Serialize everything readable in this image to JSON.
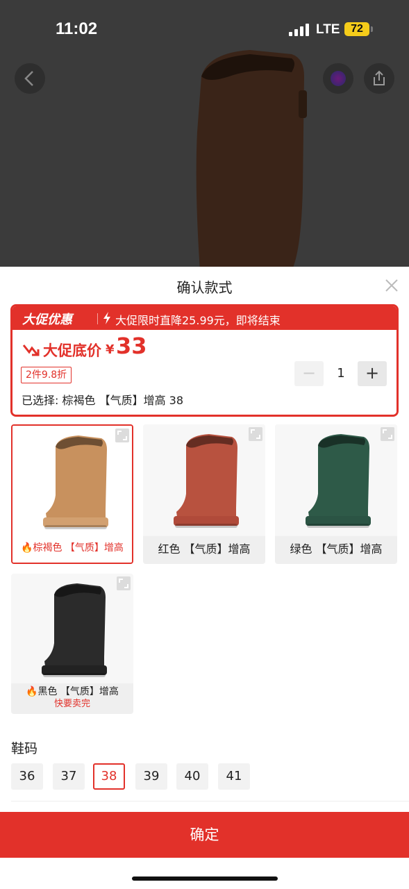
{
  "status": {
    "time": "11:02",
    "network": "LTE",
    "battery": "72"
  },
  "sheet": {
    "title": "确认款式"
  },
  "promo": {
    "brand": "大促优惠",
    "banner_text": "大促限时直降25.99元，即将结束",
    "price_label": "大促底价",
    "currency": "¥",
    "price": "33",
    "discount_tag": "2件9.8折",
    "selected": "已选择: 棕褐色 【气质】增高 38"
  },
  "quantity": {
    "minus": "−",
    "value": "1",
    "plus": "+"
  },
  "variants": [
    {
      "name": "棕褐色 【气质】增高",
      "color": "#c8915e",
      "sole": "#d2a070",
      "selected": true,
      "flame": true,
      "note": ""
    },
    {
      "name": "红色 【气质】增高",
      "color": "#b8523f",
      "sole": "#b04a3a",
      "selected": false,
      "flame": false,
      "note": ""
    },
    {
      "name": "绿色 【气质】增高",
      "color": "#2e5a48",
      "sole": "#2b5444",
      "selected": false,
      "flame": false,
      "note": ""
    },
    {
      "name": "黑色 【气质】增高",
      "color": "#2b2b2b",
      "sole": "#222222",
      "selected": false,
      "flame": true,
      "note": "快要卖完"
    }
  ],
  "sizes": {
    "title": "鞋码",
    "options": [
      "36",
      "37",
      "38",
      "39",
      "40",
      "41"
    ],
    "selected": "38"
  },
  "confirm": {
    "label": "确定"
  },
  "colors": {
    "accent": "#e2312a",
    "hero_boot": "#3a2418"
  }
}
